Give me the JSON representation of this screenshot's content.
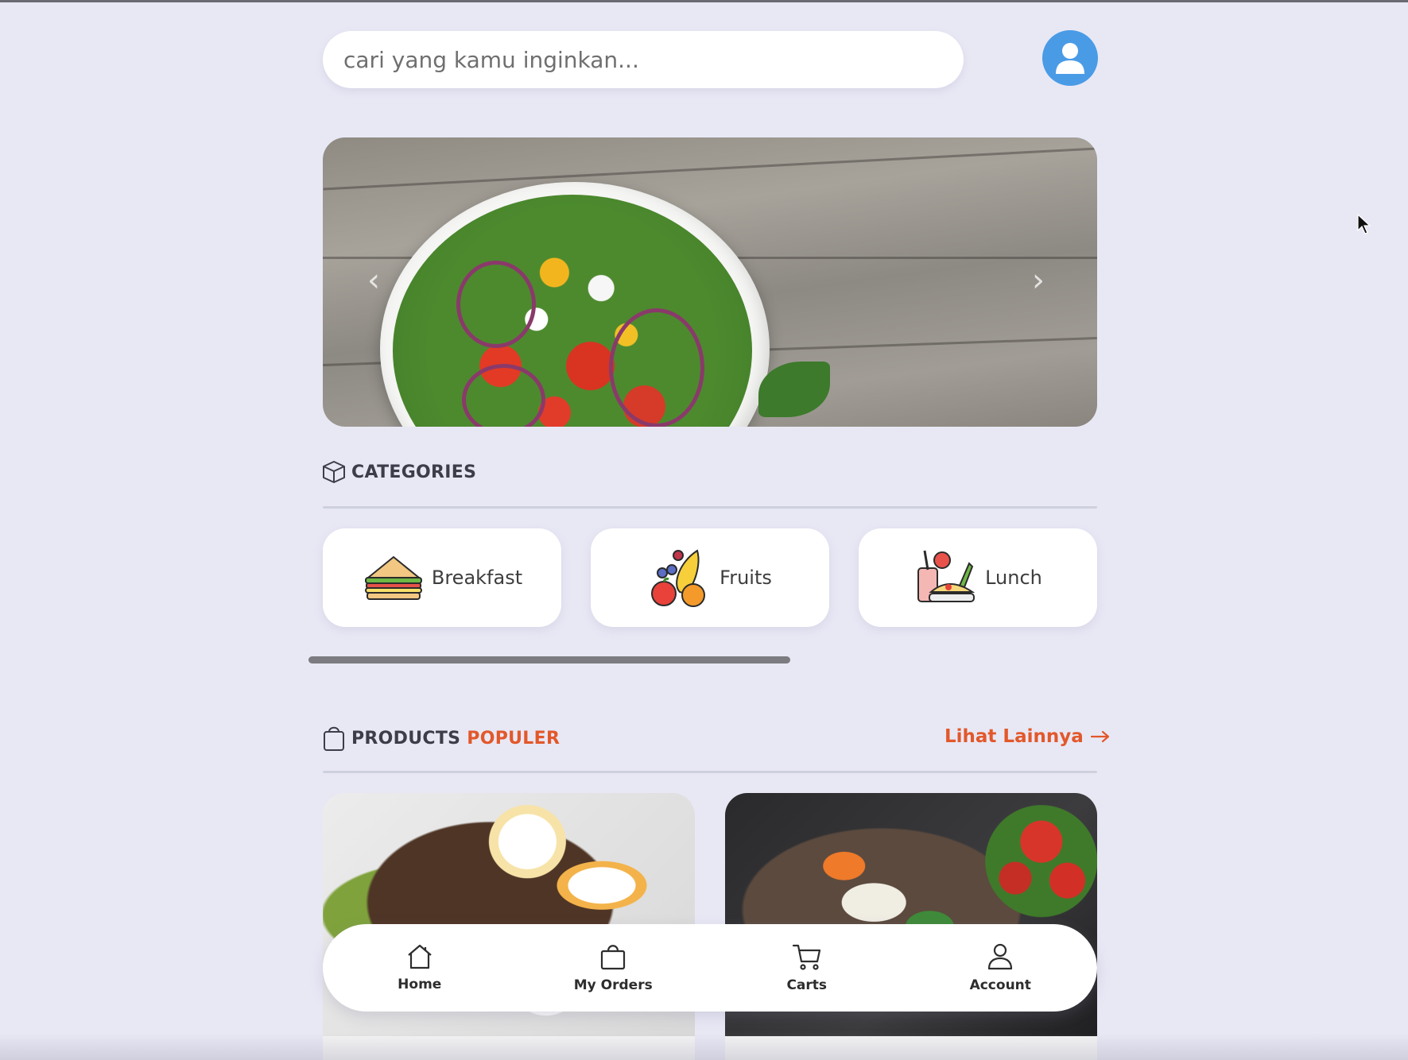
{
  "search": {
    "placeholder": "cari yang kamu inginkan..."
  },
  "categories": {
    "title": "CATEGORIES",
    "items": [
      {
        "label": "Breakfast",
        "icon": "sandwich-icon"
      },
      {
        "label": "Fruits",
        "icon": "fruits-icon"
      },
      {
        "label": "Lunch",
        "icon": "lunch-icon"
      }
    ]
  },
  "products": {
    "title": "PRODUCTS",
    "title_accent": "POPULER",
    "see_more": "Lihat Lainnya"
  },
  "nav": {
    "items": [
      {
        "label": "Home",
        "icon": "home-icon"
      },
      {
        "label": "My Orders",
        "icon": "shopping-bag-icon"
      },
      {
        "label": "Carts",
        "icon": "cart-icon"
      },
      {
        "label": "Account",
        "icon": "user-icon"
      }
    ]
  },
  "colors": {
    "background": "#e8e8f5",
    "accent": "#e2582a",
    "avatar": "#4a9be6"
  }
}
